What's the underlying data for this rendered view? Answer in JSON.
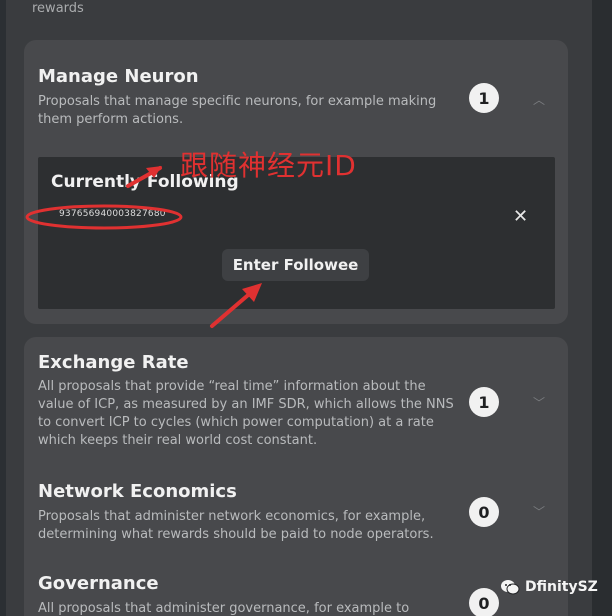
{
  "header": {
    "rewards_text": "rewards"
  },
  "topics": [
    {
      "title": "Manage Neuron",
      "description": "Proposals that manage specific neurons, for example making them perform actions.",
      "count": "1",
      "expanded": true,
      "following": {
        "title": "Currently Following",
        "neuron_id": "9376569400038276​80",
        "remove_icon": "close-icon",
        "enter_button_label": "Enter Followee"
      }
    },
    {
      "title": "Exchange Rate",
      "description": "All proposals that provide “real time” information about the value of ICP, as measured by an IMF SDR, which allows the NNS to convert ICP to cycles (which power computation) at a rate which keeps their real world cost constant.",
      "count": "1"
    },
    {
      "title": "Network Economics",
      "description": "Proposals that administer network economics, for example, determining what rewards should be paid to node operators.",
      "count": "0"
    },
    {
      "title": "Governance",
      "description": "All proposals that administer governance, for example to",
      "count": "0"
    }
  ],
  "annotation": {
    "text": "跟随神经元ID",
    "color": "#e03131"
  },
  "watermark": {
    "text": "DfinitySZ"
  },
  "colors": {
    "card_bg": "#48494c",
    "modal_bg": "#3a3c3f",
    "follow_box_bg": "#2d2f31",
    "badge_bg": "#f1f1f1",
    "annotation_red": "#e03131"
  }
}
